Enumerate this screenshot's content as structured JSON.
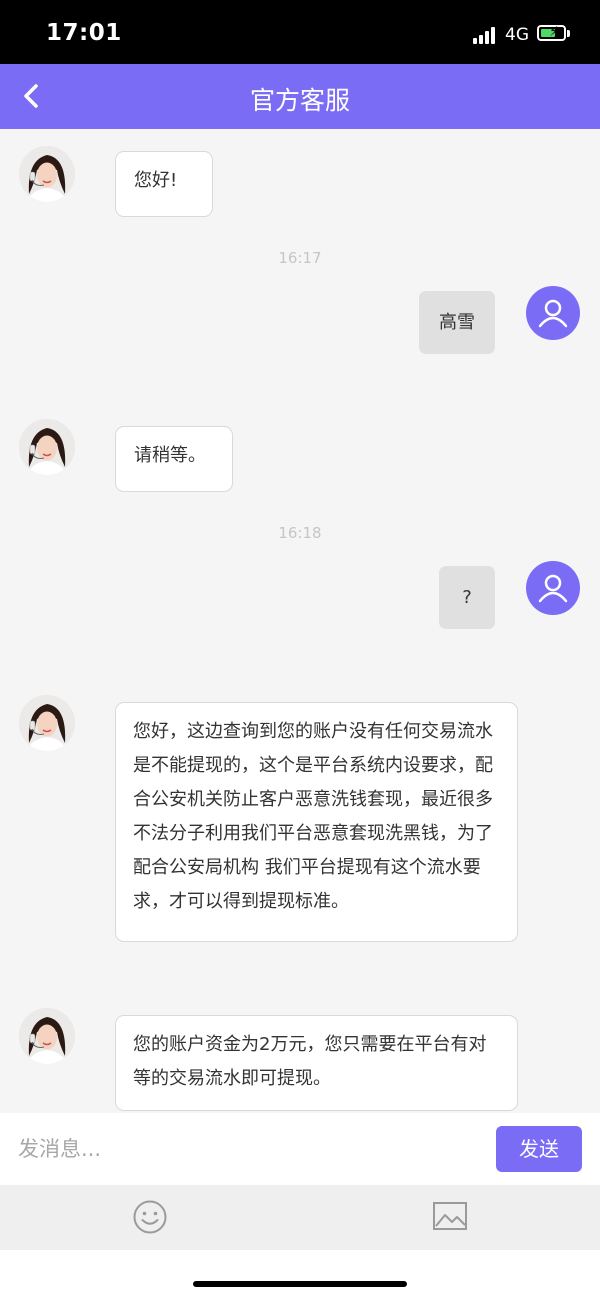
{
  "status_bar": {
    "time": "17:01",
    "network": "4G"
  },
  "header": {
    "title": "官方客服",
    "back_icon": "chevron-left-icon"
  },
  "messages": [
    {
      "sender": "agent",
      "text": "您好!"
    },
    {
      "sender": "timestamp",
      "text": "16:17"
    },
    {
      "sender": "user",
      "text": "高雪"
    },
    {
      "sender": "agent",
      "text": "请稍等。"
    },
    {
      "sender": "timestamp",
      "text": "16:18"
    },
    {
      "sender": "user",
      "text": "?"
    },
    {
      "sender": "agent",
      "text": "您好，这边查询到您的账户没有任何交易流水是不能提现的，这个是平台系统内设要求，配合公安机关防止客户恶意洗钱套现，最近很多不法分子利用我们平台恶意套现洗黑钱，为了配合公安局机构 我们平台提现有这个流水要求，才可以得到提现标准。"
    },
    {
      "sender": "agent",
      "text": "您的账户资金为2万元，您只需要在平台有对等的交易流水即可提现。"
    }
  ],
  "input": {
    "placeholder": "发消息...",
    "value": ""
  },
  "send_button": {
    "label": "发送"
  },
  "toolbar": {
    "emoji_icon": "smiley-icon",
    "image_icon": "image-icon"
  },
  "colors": {
    "accent": "#7b6cf6",
    "status_bar": "#000000",
    "background": "#f5f5f5",
    "battery": "#4cd964"
  }
}
